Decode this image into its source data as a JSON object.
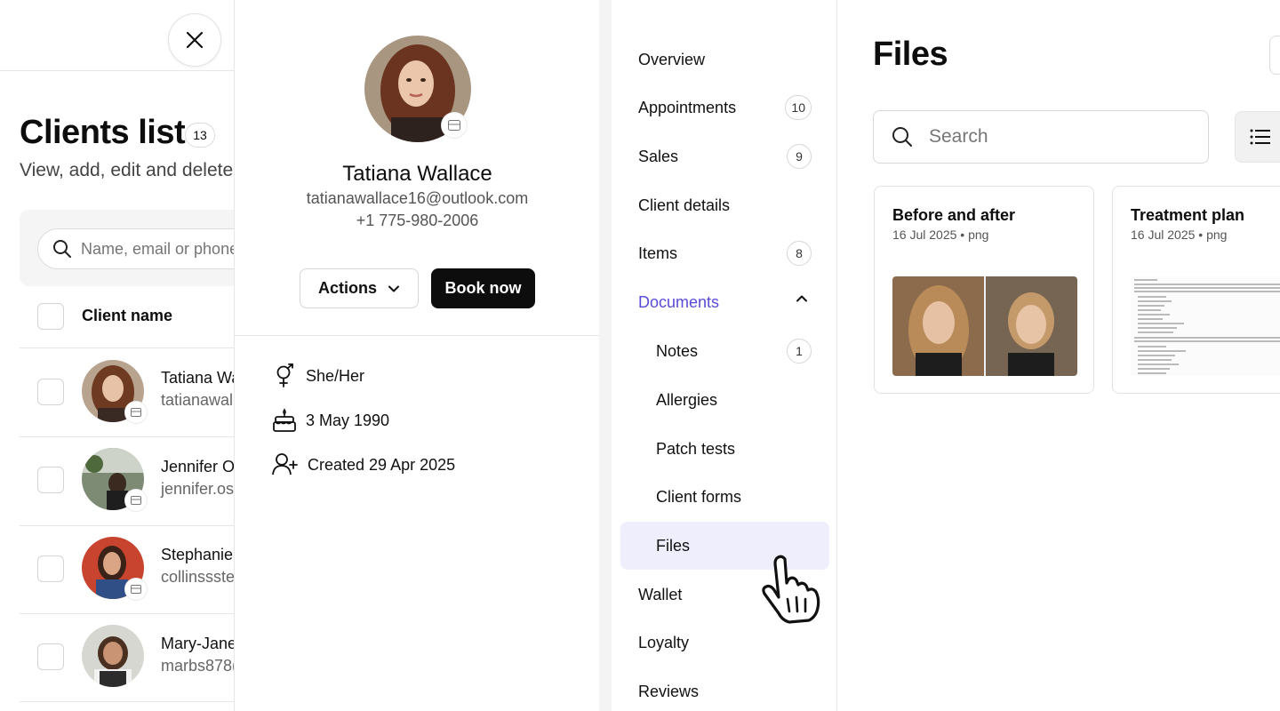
{
  "clients": {
    "title": "Clients list",
    "count": "13",
    "subtitle": "View, add, edit and delete y",
    "search_placeholder": "Name, email or phone",
    "column_label": "Client name",
    "rows": [
      {
        "name": "Tatiana Wa",
        "email": "tatianawall"
      },
      {
        "name": "Jennifer Os",
        "email": "jennifer.osn"
      },
      {
        "name": "Stephanie",
        "email": "collinssste"
      },
      {
        "name": "Mary-Jane",
        "email": "marbs878("
      }
    ]
  },
  "profile": {
    "name": "Tatiana Wallace",
    "email": "tatianawallace16@outlook.com",
    "phone": "+1 775-980-2006",
    "actions_label": "Actions",
    "book_label": "Book now",
    "pronouns": "She/Her",
    "birthday": "3 May 1990",
    "created": "Created 29 Apr 2025"
  },
  "nav": {
    "items": [
      {
        "label": "Overview",
        "badge": null
      },
      {
        "label": "Appointments",
        "badge": "10"
      },
      {
        "label": "Sales",
        "badge": "9"
      },
      {
        "label": "Client details",
        "badge": null
      },
      {
        "label": "Items",
        "badge": "8"
      },
      {
        "label": "Documents",
        "badge": null
      },
      {
        "label": "Notes",
        "badge": "1"
      },
      {
        "label": "Allergies",
        "badge": null
      },
      {
        "label": "Patch tests",
        "badge": null
      },
      {
        "label": "Client forms",
        "badge": null
      },
      {
        "label": "Files",
        "badge": null
      },
      {
        "label": "Wallet",
        "badge": null
      },
      {
        "label": "Loyalty",
        "badge": null
      },
      {
        "label": "Reviews",
        "badge": null
      }
    ]
  },
  "files": {
    "title": "Files",
    "search_placeholder": "Search",
    "cards": [
      {
        "title": "Before and after",
        "meta": "16 Jul 2025 • png"
      },
      {
        "title": "Treatment plan",
        "meta": "16 Jul 2025 • png"
      }
    ]
  },
  "colors": {
    "accent": "#5a4bd6",
    "active_bg": "#eeeefc",
    "primary_button": "#0d0d0d"
  }
}
